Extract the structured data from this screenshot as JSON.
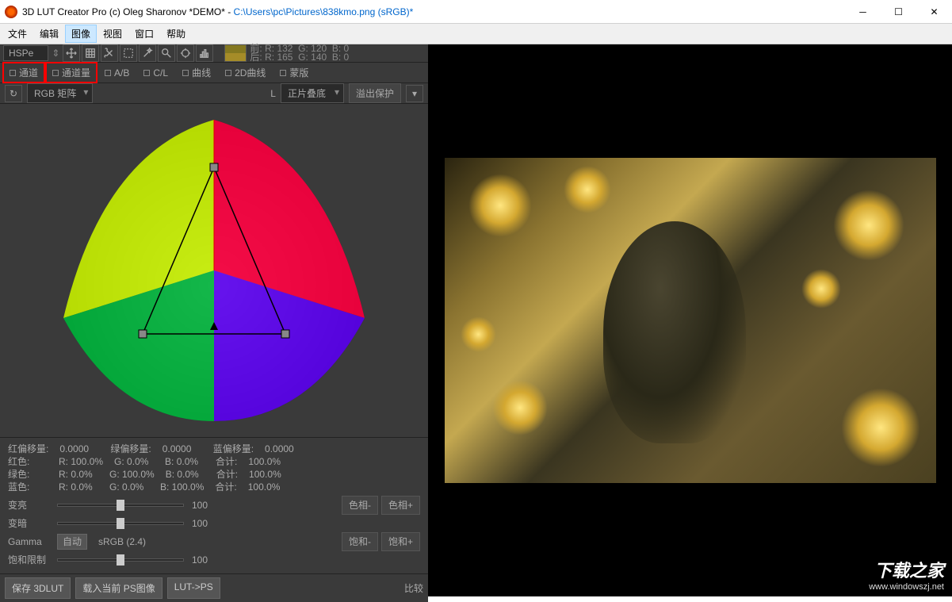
{
  "titlebar": {
    "app": "3D LUT Creator Pro (c) Oleg Sharonov *DEMO* - ",
    "path": "C:\\Users\\pc\\Pictures\\838kmo.png (sRGB)*"
  },
  "menu": {
    "file": "文件",
    "edit": "编辑",
    "image": "图像",
    "view": "视图",
    "window": "窗口",
    "help": "帮助"
  },
  "toolbar": {
    "colorspace": "HSPe",
    "front_label": "前:",
    "back_label": "后:",
    "front_r": "R: 132",
    "front_g": "G: 120",
    "front_b": "B:   0",
    "back_r": "R: 165",
    "back_g": "G: 140",
    "back_b": "B:   0"
  },
  "tabs": {
    "channel": "通道",
    "volume": "通道量",
    "ab": "A/B",
    "cl": "C/L",
    "curve": "曲线",
    "curve2d": "2D曲线",
    "mask": "蒙版"
  },
  "sub": {
    "matrix": "RGB 矩阵",
    "l_label": "L",
    "blend": "正片叠底",
    "overflow": "溢出保护"
  },
  "info": {
    "red_offset_label": "红偏移量:",
    "red_offset": "0.0000",
    "green_offset_label": "绿偏移量:",
    "green_offset": "0.0000",
    "blue_offset_label": "蓝偏移量:",
    "blue_offset": "0.0000",
    "red_label": "红色:",
    "green_label": "绿色:",
    "blue_label": "蓝色:",
    "sum_label": "合计:",
    "r100": "R: 100.0%",
    "g100": "G: 100.0%",
    "b100": "B: 100.0%",
    "r0": "R: 0.0%",
    "g0": "G: 0.0%",
    "b0": "B: 0.0%",
    "sum": "100.0%"
  },
  "sliders": {
    "lighten": "变亮",
    "lighten_val": "100",
    "darken": "变暗",
    "darken_val": "100",
    "gamma": "Gamma",
    "auto": "自动",
    "gamma_mode": "sRGB (2.4)",
    "satlimit": "饱和限制",
    "satlimit_val": "100",
    "hue_minus": "色相-",
    "hue_plus": "色相+",
    "sat_minus": "饱和-",
    "sat_plus": "饱和+"
  },
  "actions": {
    "save": "保存 3DLUT",
    "loadps": "载入当前 PS图像",
    "lutps": "LUT->PS",
    "compare": "比较"
  },
  "watermark": {
    "text": "下载之家",
    "url": "www.windowszj.net"
  }
}
